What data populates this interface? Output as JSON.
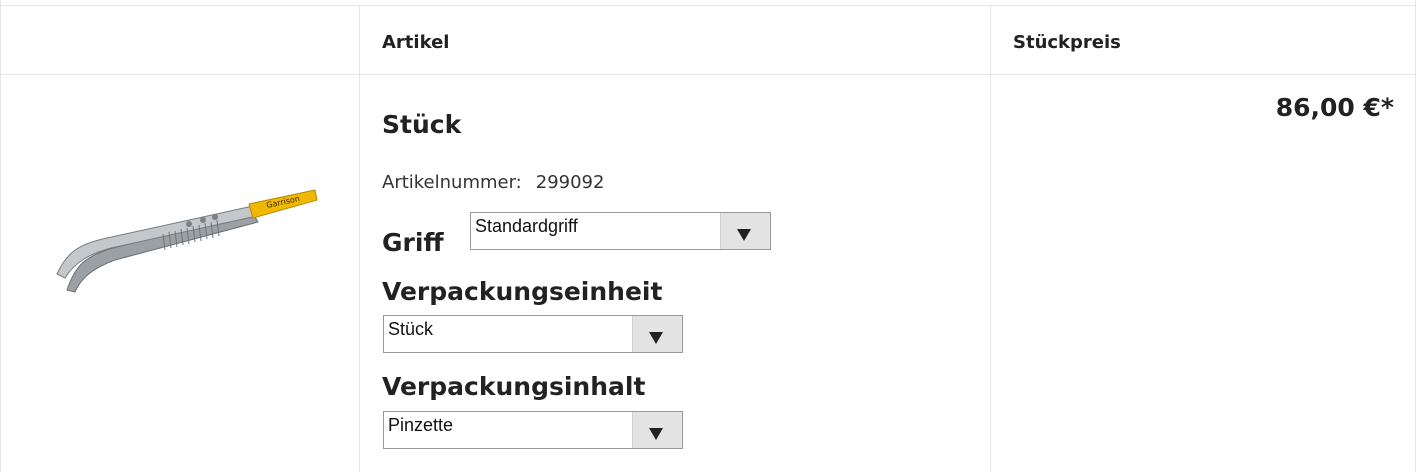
{
  "table": {
    "headers": {
      "article": "Artikel",
      "price": "Stückpreis"
    }
  },
  "product": {
    "image": "tweezers-image",
    "brand_on_image": "Garrison",
    "title": "Stück",
    "article_number_label": "Artikelnummer:",
    "article_number": "299092",
    "price": "86,00 €*"
  },
  "options": {
    "griff": {
      "label": "Griff",
      "selected": "Standardgriff"
    },
    "verpackungseinheit": {
      "label": "Verpackungseinheit",
      "selected": "Stück"
    },
    "verpackungsinhalt": {
      "label": "Verpackungsinhalt",
      "selected": "Pinzette"
    }
  },
  "colors": {
    "text": "#222222",
    "border": "#e6e6e6",
    "select_button": "#e3e3e3",
    "brand_band": "#f0b800"
  }
}
